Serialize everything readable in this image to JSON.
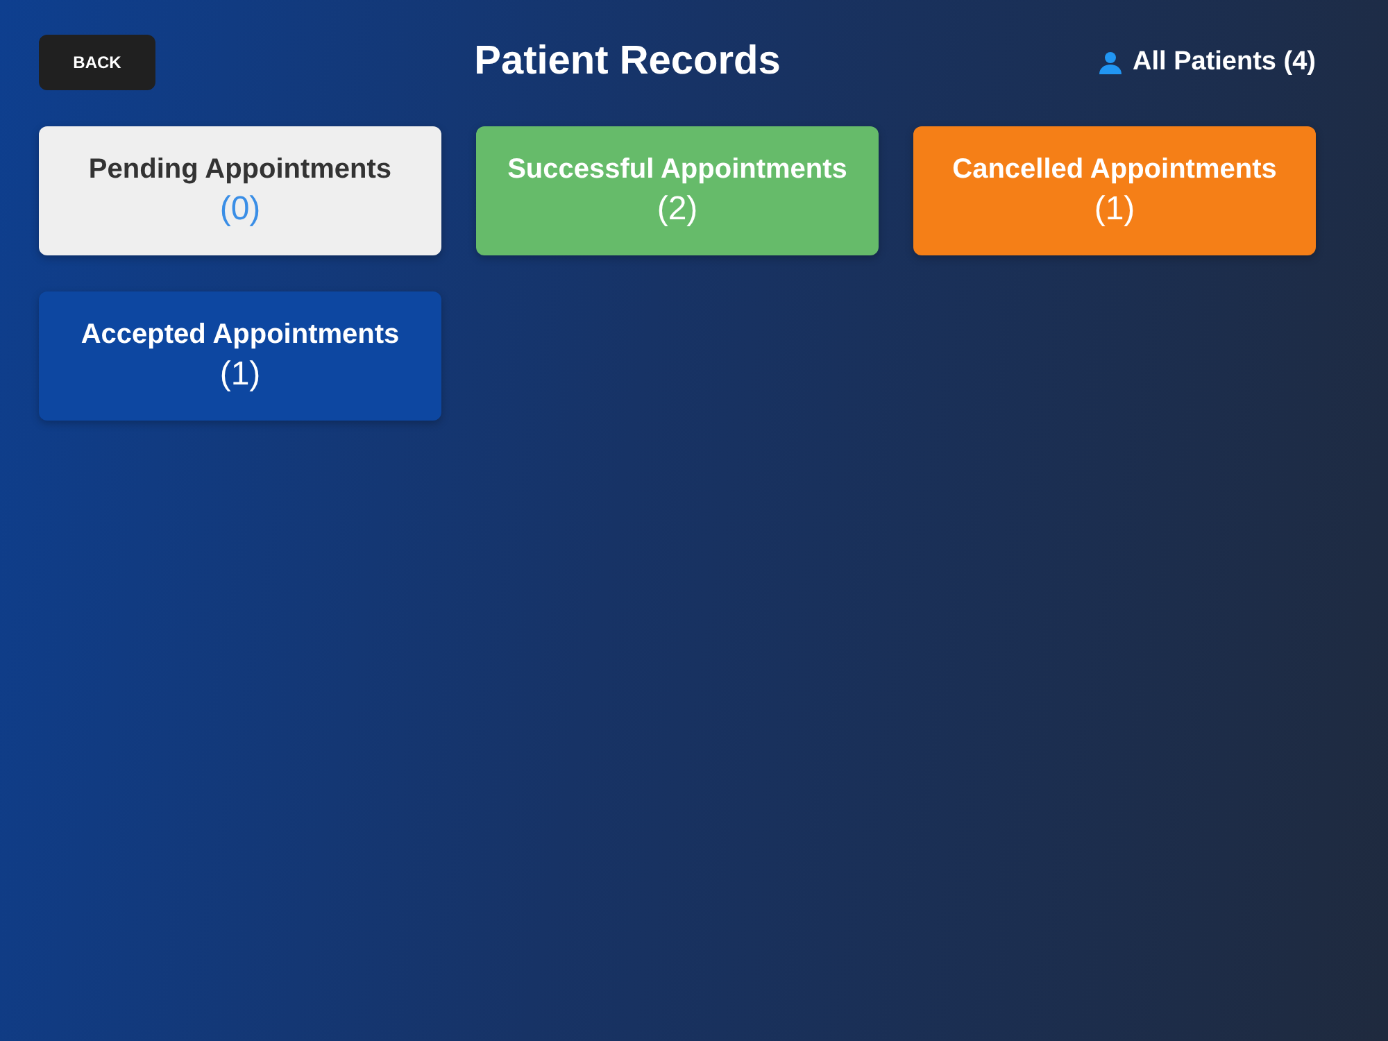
{
  "header": {
    "back_button": "BACK",
    "title": "Patient Records",
    "all_patients": "All Patients (4)"
  },
  "cards": [
    {
      "label": "Pending Appointments",
      "count": "(0)",
      "color": "#efefef"
    },
    {
      "label": "Successful Appointments",
      "count": "(2)",
      "color": "#66bb6a"
    },
    {
      "label": "Cancelled Appointments",
      "count": "(1)",
      "color": "#f57f17"
    },
    {
      "label": "Accepted Appointments",
      "count": "(1)",
      "color": "#0d47a1"
    }
  ]
}
